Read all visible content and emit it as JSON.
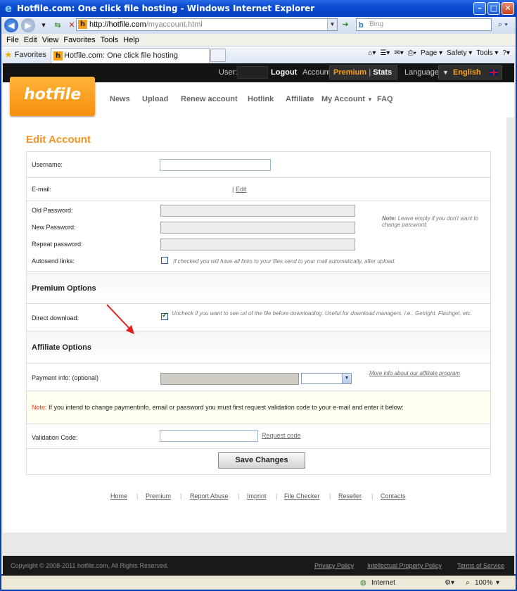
{
  "window": {
    "title": "Hotfile.com: One click file hosting - Windows Internet Explorer"
  },
  "browser": {
    "url_host": "http://hotfile.com",
    "url_path": "/myaccount.html",
    "search_placeholder": "Bing",
    "menu": [
      "File",
      "Edit",
      "View",
      "Favorites",
      "Tools",
      "Help"
    ],
    "favorites_label": "Favorites",
    "tab_title": "Hotfile.com: One click file hosting",
    "commands": [
      "Page ▾",
      "Safety ▾",
      "Tools ▾"
    ],
    "status_zone": "Internet",
    "zoom": "100%"
  },
  "topbar": {
    "user_label": "User:",
    "logout": "Logout",
    "account_label": "Account:",
    "premium": "Premium",
    "stats": "Stats",
    "language_label": "Language:",
    "language": "English"
  },
  "header": {
    "logo": "hotfile",
    "nav": [
      "News",
      "Upload",
      "Renew account",
      "Hotlink",
      "Affiliate",
      "My Account",
      "FAQ"
    ]
  },
  "form": {
    "title": "Edit Account",
    "username_label": "Username:",
    "email_label": "E-mail:",
    "email_sep": "|",
    "email_edit": "Edit",
    "old_password_label": "Old Password:",
    "new_password_label": "New Password:",
    "repeat_password_label": "Repeat password:",
    "password_note_bold": "Note:",
    "password_note": " Leave empty if you don't want to change password.",
    "autosend_label": "Autosend links:",
    "autosend_note": "If checked you will have all links to your files send to your mail automatically, after upload.",
    "premium_section": "Premium Options",
    "direct_label": "Direct download:",
    "direct_note": "Uncheck if you want to see url of the file before downloading. Useful for download managers, i.e., Getright, Flashget, etc.",
    "affiliate_section": "Affiliate Options",
    "payment_label": "Payment info: (optional)",
    "affiliate_link": "More info about our affiliate program",
    "warning_bold": "Note:",
    "warning_text": " If you intend to change paymentinfo, email or password you must first request validation code to your e-mail and enter it below:",
    "validation_label": "Validation Code:",
    "request_code": "Request code",
    "save": "Save Changes"
  },
  "footer_links": [
    "Home",
    "Premium",
    "Report Abuse",
    "Imprint",
    "File Checker",
    "Reseller",
    "Contacts"
  ],
  "footer": {
    "copyright": "Copyright © 2008-2011 hotfile.com, All Rights Reserved.",
    "links": [
      "Privacy Policy",
      "Intellectual Property Policy",
      "Terms of Service"
    ]
  }
}
